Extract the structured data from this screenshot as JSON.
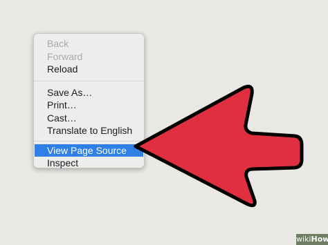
{
  "context_menu": {
    "group1": [
      {
        "label": "Back",
        "state": "disabled"
      },
      {
        "label": "Forward",
        "state": "disabled"
      },
      {
        "label": "Reload",
        "state": "enabled"
      }
    ],
    "group2": [
      {
        "label": "Save As…",
        "state": "enabled"
      },
      {
        "label": "Print…",
        "state": "enabled"
      },
      {
        "label": "Cast…",
        "state": "enabled"
      },
      {
        "label": "Translate to English",
        "state": "enabled"
      }
    ],
    "group3": [
      {
        "label": "View Page Source",
        "state": "highlighted"
      },
      {
        "label": "Inspect",
        "state": "enabled"
      }
    ]
  },
  "pointer_arrow": {
    "icon": "red-left-arrow-icon",
    "fill_color": "#e0303f",
    "outline_color": "#000000"
  },
  "watermark": {
    "prefix": "wiki",
    "suffix": "How"
  },
  "colors": {
    "background": "#e9e8e5",
    "menu_background": "#ededeb",
    "highlight": "#2f7fe6",
    "disabled_text": "#a9a9a7"
  }
}
